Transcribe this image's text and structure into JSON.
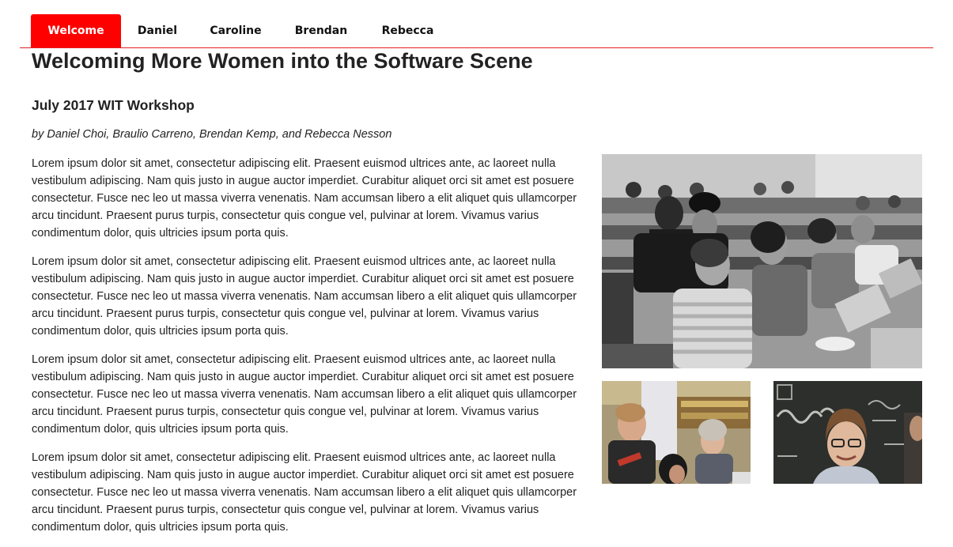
{
  "nav": {
    "tabs": [
      {
        "label": "Welcome",
        "active": true
      },
      {
        "label": "Daniel",
        "active": false
      },
      {
        "label": "Caroline",
        "active": false
      },
      {
        "label": "Brendan",
        "active": false
      },
      {
        "label": "Rebecca",
        "active": false
      }
    ]
  },
  "article": {
    "title": "Welcoming More Women into the Software Scene",
    "subtitle": "July 2017 WIT Workshop",
    "byline": "by Daniel Choi, Braulio Carreno, Brendan Kemp, and Rebecca Nesson",
    "paragraphs": [
      "Lorem ipsum dolor sit amet, consectetur adipiscing elit. Praesent euismod ultrices ante, ac laoreet nulla vestibulum adipiscing. Nam quis justo in augue auctor imperdiet. Curabitur aliquet orci sit amet est posuere consectetur. Fusce nec leo ut massa viverra venenatis. Nam accumsan libero a elit aliquet quis ullamcorper arcu tincidunt. Praesent purus turpis, consectetur quis congue vel, pulvinar at lorem. Vivamus varius condimentum dolor, quis ultricies ipsum porta quis.",
      "Lorem ipsum dolor sit amet, consectetur adipiscing elit. Praesent euismod ultrices ante, ac laoreet nulla vestibulum adipiscing. Nam quis justo in augue auctor imperdiet. Curabitur aliquet orci sit amet est posuere consectetur. Fusce nec leo ut massa viverra venenatis. Nam accumsan libero a elit aliquet quis ullamcorper arcu tincidunt. Praesent purus turpis, consectetur quis congue vel, pulvinar at lorem. Vivamus varius condimentum dolor, quis ultricies ipsum porta quis.",
      "Lorem ipsum dolor sit amet, consectetur adipiscing elit. Praesent euismod ultrices ante, ac laoreet nulla vestibulum adipiscing. Nam quis justo in augue auctor imperdiet. Curabitur aliquet orci sit amet est posuere consectetur. Fusce nec leo ut massa viverra venenatis. Nam accumsan libero a elit aliquet quis ullamcorper arcu tincidunt. Praesent purus turpis, consectetur quis congue vel, pulvinar at lorem. Vivamus varius condimentum dolor, quis ultricies ipsum porta quis.",
      "Lorem ipsum dolor sit amet, consectetur adipiscing elit. Praesent euismod ultrices ante, ac laoreet nulla vestibulum adipiscing. Nam quis justo in augue auctor imperdiet. Curabitur aliquet orci sit amet est posuere consectetur. Fusce nec leo ut massa viverra venenatis. Nam accumsan libero a elit aliquet quis ullamcorper arcu tincidunt. Praesent purus turpis, consectetur quis congue vel, pulvinar at lorem. Vivamus varius condimentum dolor, quis ultricies ipsum porta quis."
    ]
  },
  "colors": {
    "accent": "#ff0000",
    "divider": "#e02020",
    "text": "#222222"
  },
  "photos": {
    "classroom_scene": "grayscale-classroom-photo",
    "workshop_scene": "color-workshop-photo",
    "chalkboard_scene": "color-chalkboard-portrait"
  }
}
